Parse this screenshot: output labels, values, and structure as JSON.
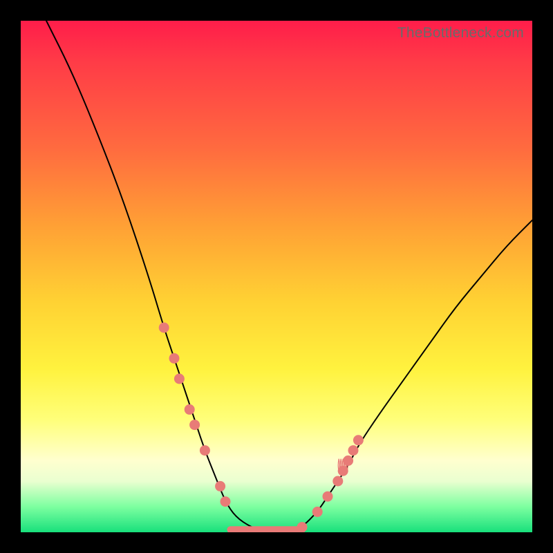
{
  "watermark": "TheBottleneck.com",
  "colors": {
    "frame": "#000000",
    "curve": "#000000",
    "marker": "#e87b77",
    "gradient_stops": [
      "#ff1d4a",
      "#ff3b47",
      "#ff6b3f",
      "#ffa035",
      "#ffd233",
      "#fff23e",
      "#ffff7a",
      "#ffffcf",
      "#eaffd0",
      "#7dffa0",
      "#18e07c"
    ]
  },
  "chart_data": {
    "type": "line",
    "title": "",
    "xlabel": "",
    "ylabel": "",
    "xlim": [
      0,
      100
    ],
    "ylim": [
      0,
      100
    ],
    "grid": false,
    "legend": false,
    "description": "V-shaped bottleneck curve. Y is bottleneck percentage (100 at top, 0 at bottom). Curve descends steeply from top-left, flattens near zero around x 41–55, then rises toward the right with lower slope, reaching roughly 60 at the right edge. Salmon markers cluster on the descending limb between roughly x 28–40 and on the ascending limb between roughly x 55–66; a thick salmon segment marks the flat minimum.",
    "series": [
      {
        "name": "bottleneck-curve",
        "x": [
          5,
          10,
          15,
          20,
          25,
          28,
          30,
          32,
          34,
          36,
          38,
          40,
          42,
          45,
          48,
          50,
          53,
          55,
          58,
          60,
          62,
          64,
          66,
          70,
          75,
          80,
          85,
          90,
          95,
          100
        ],
        "y": [
          100,
          90,
          78,
          65,
          50,
          40,
          34,
          28,
          22,
          16,
          11,
          6,
          3,
          1,
          0,
          0,
          0,
          1,
          4,
          7,
          10,
          13,
          17,
          23,
          30,
          37,
          44,
          50,
          56,
          61
        ]
      }
    ],
    "markers_left": [
      [
        28,
        40
      ],
      [
        30,
        34
      ],
      [
        31,
        30
      ],
      [
        33,
        24
      ],
      [
        34,
        21
      ],
      [
        36,
        16
      ],
      [
        39,
        9
      ],
      [
        40,
        6
      ]
    ],
    "markers_right": [
      [
        55,
        1
      ],
      [
        58,
        4
      ],
      [
        60,
        7
      ],
      [
        62,
        10
      ],
      [
        63,
        12
      ],
      [
        64,
        14
      ],
      [
        65,
        16
      ],
      [
        66,
        18
      ]
    ],
    "flat_segment": {
      "x0": 41,
      "x1": 55,
      "y": 0.5
    },
    "scribble_near": [
      63,
      13
    ]
  }
}
